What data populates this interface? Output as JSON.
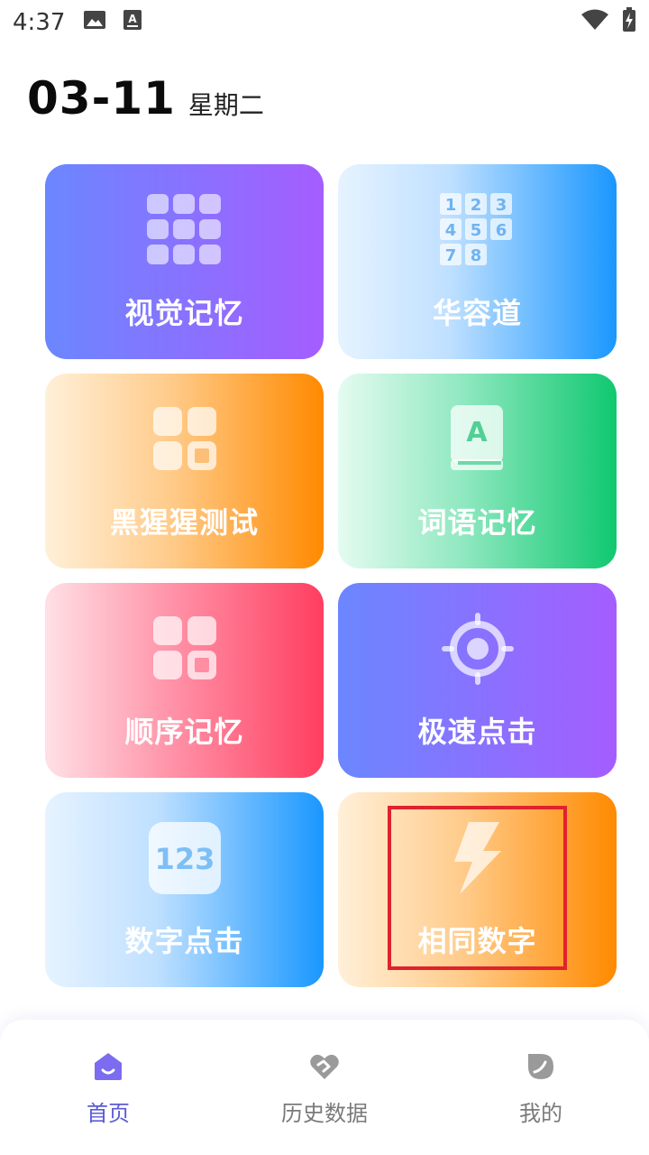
{
  "status_bar": {
    "time": "4:37",
    "icons": [
      "image-icon",
      "a-badge-icon",
      "wifi-icon",
      "battery-charging-icon"
    ]
  },
  "header": {
    "date": "03-11",
    "weekday": "星期二"
  },
  "games": [
    {
      "label": "视觉记忆",
      "icon": "grid-dots-icon"
    },
    {
      "label": "华容道",
      "icon": "number-puzzle-icon"
    },
    {
      "label": "黑猩猩测试",
      "icon": "tiles-icon"
    },
    {
      "label": "词语记忆",
      "icon": "book-a-icon"
    },
    {
      "label": "顺序记忆",
      "icon": "tiles-icon"
    },
    {
      "label": "极速点击",
      "icon": "target-icon"
    },
    {
      "label": "数字点击",
      "icon": "number-123-icon"
    },
    {
      "label": "相同数字",
      "icon": "lightning-icon"
    }
  ],
  "puzzle_digits": [
    "1",
    "2",
    "3",
    "4",
    "5",
    "6",
    "7",
    "8"
  ],
  "number_icon_text": "123",
  "book_icon_text": "A",
  "bottom_nav": [
    {
      "label": "首页",
      "icon": "home-icon",
      "active": true
    },
    {
      "label": "历史数据",
      "icon": "heart-hand-icon",
      "active": false
    },
    {
      "label": "我的",
      "icon": "leaf-icon",
      "active": false
    }
  ],
  "colors": {
    "accent": "#5b5bd6",
    "highlight": "#e0222d"
  }
}
